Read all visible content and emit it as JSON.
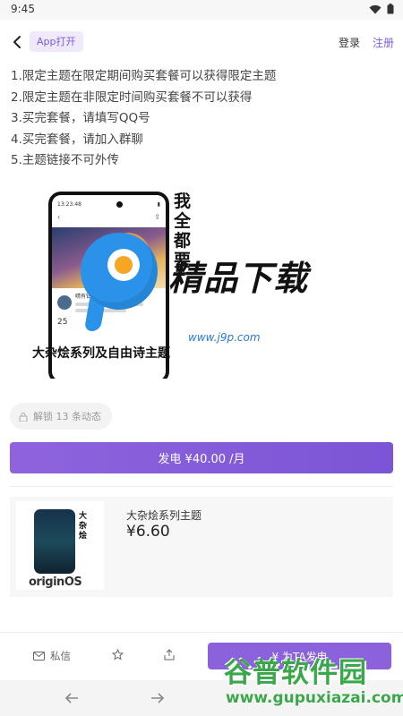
{
  "status_bar": {
    "time": "9:45"
  },
  "nav": {
    "app_open": "App打开",
    "login": "登录",
    "register": "注册"
  },
  "description": [
    "1.限定主题在限定期间购买套餐可以获得限定主题",
    "2.限定主题在非限定时间购买套餐不可以获得",
    "3.买完套餐，请填写QQ号",
    "4.买完套餐，请加入群聊",
    "5.主题链接不可外传"
  ],
  "promo": {
    "side_text": "我全都要",
    "caption": "大杂烩系列及自由诗主题",
    "phone_time": "13:23:48",
    "phone_name": "晴有钻落的刺桐",
    "phone_number": "25"
  },
  "watermark": {
    "title": "精品下载",
    "url": "www.j9p.com"
  },
  "unlock": {
    "label": "解锁 13 条动态"
  },
  "sponsor": {
    "label": "发电 ¥40.00 /月"
  },
  "product": {
    "title": "大杂烩系列主题",
    "price": "¥6.60",
    "thumb_text": "大杂烩",
    "thumb_brand": "originOS"
  },
  "bottom_bar": {
    "message": "私信",
    "sponsor": "¥ 为TA发电"
  },
  "watermark2": {
    "title": "谷普软件园",
    "url": "www.gupuxiazai.com"
  },
  "colors": {
    "accent": "#7b55d6",
    "accent_light": "#efe9fb"
  }
}
